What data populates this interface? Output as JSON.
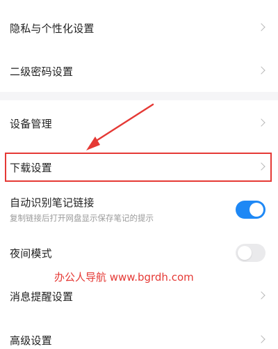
{
  "settings": {
    "privacy_label": "隐私与个性化设置",
    "secondary_password_label": "二级密码设置",
    "device_management_label": "设备管理",
    "download_settings_label": "下载设置",
    "auto_note_link": {
      "label": "自动识别笔记链接",
      "description": "复制链接后打开网盘显示保存笔记的提示",
      "enabled": true
    },
    "night_mode": {
      "label": "夜间模式",
      "enabled": false
    },
    "notification_label": "消息提醒设置",
    "advanced_label": "高级设置"
  },
  "annotation": {
    "watermark": "办公人导航  www.bgrdh.com",
    "highlight_color": "#e53935"
  },
  "colors": {
    "toggle_on": "#1e88f5",
    "toggle_off": "#eaeaec",
    "section_divider": "#f5f5f7"
  },
  "icons": {
    "chevron": "chevron-right-icon"
  }
}
